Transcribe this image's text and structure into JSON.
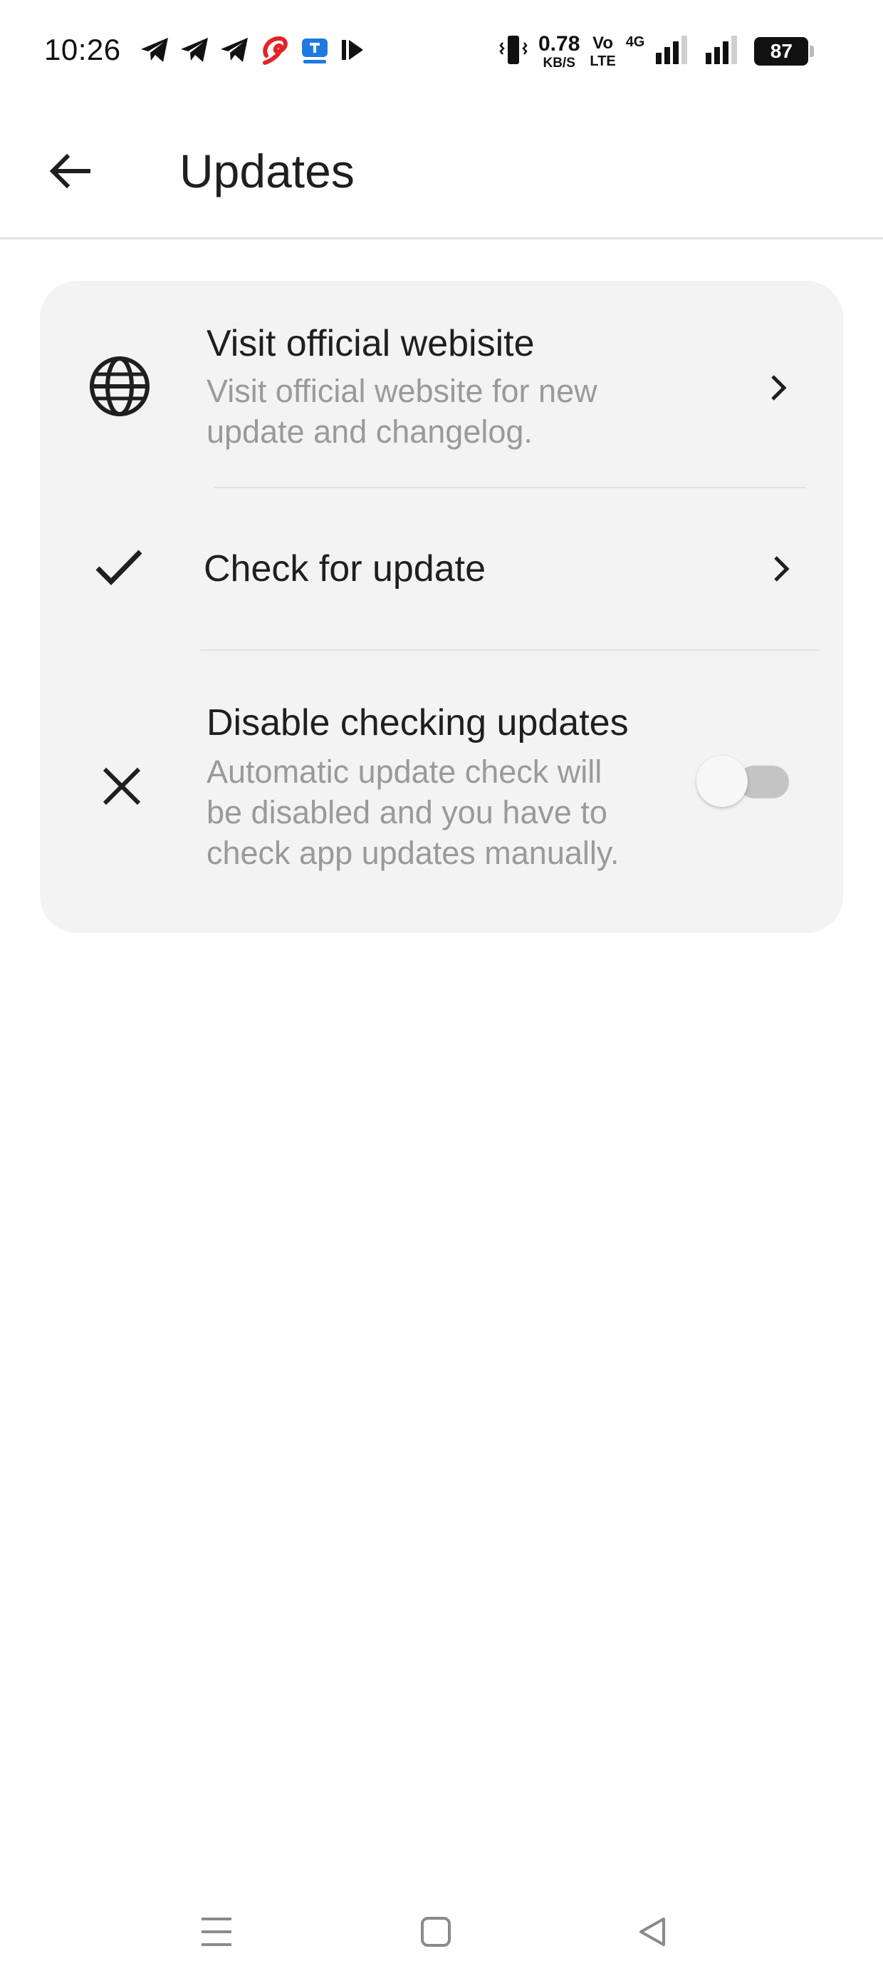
{
  "status_bar": {
    "time": "10:26",
    "speed_value": "0.78",
    "speed_unit": "KB/S",
    "volte_top": "Vo",
    "volte_bottom": "LTE",
    "network_type": "4G",
    "battery": "87",
    "left_icons": [
      "telegram-icon",
      "telegram-icon",
      "telegram-icon",
      "airtel-icon",
      "tech-app-icon",
      "play-icon"
    ],
    "right_icons": [
      "vibrate-icon",
      "signal-icon",
      "signal-icon",
      "battery-icon"
    ]
  },
  "app_bar": {
    "title": "Updates",
    "back_icon": "arrow-back-icon"
  },
  "settings": [
    {
      "title": "Visit official webisite",
      "subtitle_line1": "Visit official website for new",
      "subtitle_line2": "update and changelog.",
      "icon": "globe-icon",
      "trailing": "chevron-right-icon"
    },
    {
      "title": "Check for update",
      "icon": "check-icon",
      "trailing": "chevron-right-icon"
    },
    {
      "title": "Disable checking updates",
      "subtitle_line1": "Automatic update check will",
      "subtitle_line2": "be disabled and you have to",
      "subtitle_line3": "check app updates manually.",
      "icon": "close-icon",
      "toggle_on": false
    }
  ],
  "nav_bar": {
    "icons": [
      "menu-icon",
      "home-square-icon",
      "back-triangle-icon"
    ]
  },
  "colors": {
    "card_background": "#f3f3f3",
    "subtitle": "#9a9a9a",
    "toggle_track_off": "#c4c4c4",
    "airtel_red": "#e2232a",
    "app_blue": "#1f7ae0"
  }
}
